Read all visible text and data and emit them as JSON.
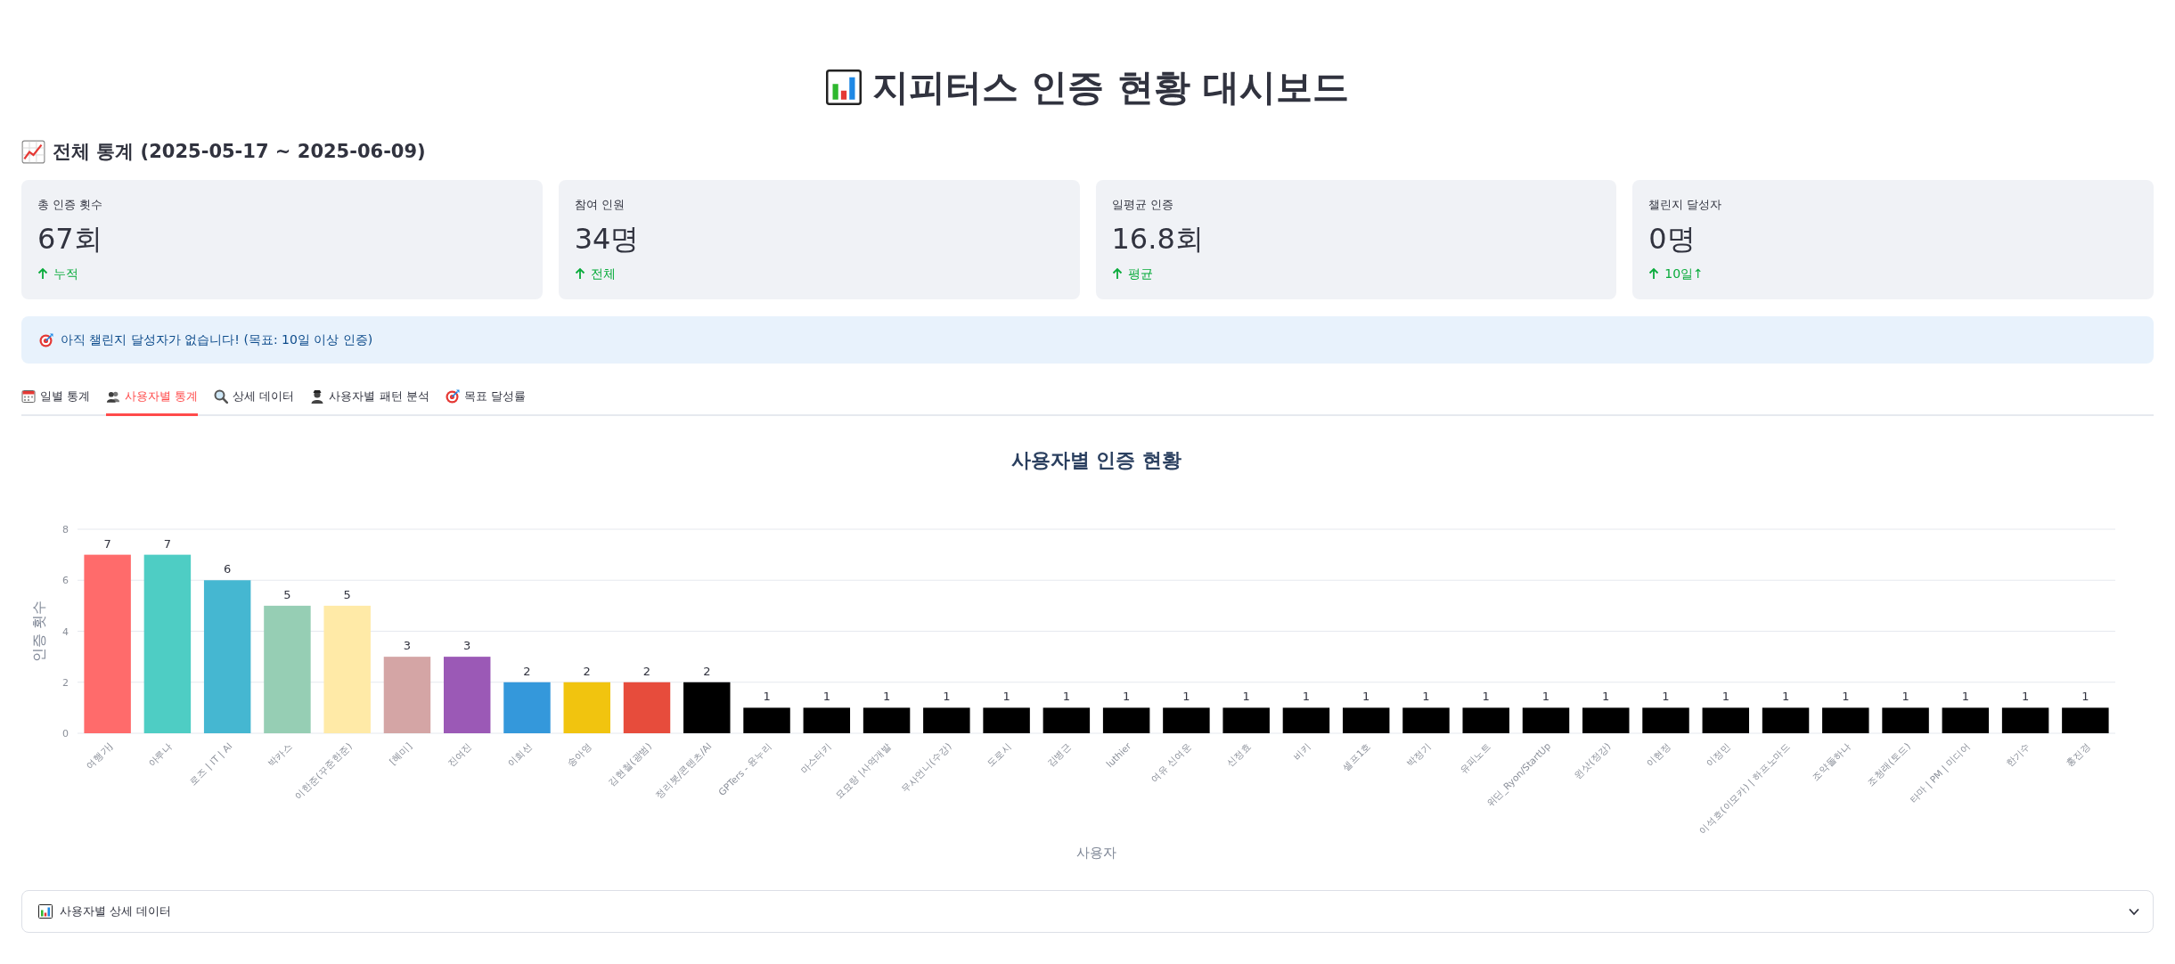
{
  "header": {
    "title": "지피터스 인증 현황 대시보드"
  },
  "overview": {
    "heading": "**전체 통계** (2025-05-17 ~ 2025-06-09)",
    "metrics": [
      {
        "label": "총 인증 횟수",
        "value": "67회",
        "delta": "누적",
        "increase": true
      },
      {
        "label": "참여 인원",
        "value": "34명",
        "delta": "전체",
        "increase": true
      },
      {
        "label": "일평균 인증",
        "value": "16.8회",
        "delta": "평균",
        "increase": true
      },
      {
        "label": "챌린지 달성자",
        "value": "0명",
        "delta": "10일↑",
        "increase": true
      }
    ]
  },
  "alert": {
    "message": "아직 챌린지 달성자가 없습니다! (목표: 10일 이상 인증)"
  },
  "tabs": [
    {
      "label": "일별 통계",
      "selected": false
    },
    {
      "label": "사용자별 통계",
      "selected": true
    },
    {
      "label": "상세 데이터",
      "selected": false
    },
    {
      "label": "사용자별 패턴 분석",
      "selected": false
    },
    {
      "label": "목표 달성률",
      "selected": false
    }
  ],
  "user_chart": {
    "chart_data": {
      "type": "bar",
      "title": "사용자별 인증 현황",
      "xlabel": "사용자",
      "ylabel": "인증 횟수",
      "categories": [
        "여행가J",
        "아루나",
        "로즈 | IT | AI",
        "박카스",
        "이한준(꾸준한준)",
        "[혜미]",
        "진여진",
        "이희선",
        "송아영",
        "김현철(광범)",
        "정리봇/콘텐츠/AI",
        "GPTers - 윤누리",
        "마스터키",
        "묘묘랑 |사역개발",
        "무사언니(수강)",
        "도로시",
        "김병근",
        "luthier",
        "여유 신여운",
        "신정효",
        "비키",
        "셀프1호",
        "박정기",
        "유피노트",
        "위딘_Ryon/StartUp",
        "윈샷(정강)",
        "이현정",
        "이정민",
        "이석호(이모카) | 하프노마드",
        "조약돌하나",
        "조청래(토드)",
        "타마 | PM | 미디어",
        "한기수",
        "홍진경"
      ],
      "series": [
        {
          "values": [
            7,
            7,
            6,
            5,
            5,
            3,
            3,
            2,
            2,
            2,
            2,
            1,
            1,
            1,
            1,
            1,
            1,
            1,
            1,
            1,
            1,
            1,
            1,
            1,
            1,
            1,
            1,
            1,
            1,
            1,
            1,
            1,
            1,
            1
          ],
          "colors": [
            "#ff6b6b",
            "#4ecdc4",
            "#45b7d1",
            "#96ceb4",
            "#ffeaa7",
            "#d4a5a5",
            "#9b59b6",
            "#3498db",
            "#f1c40f",
            "#e74c3c",
            "#000000",
            "#000000",
            "#000000",
            "#000000",
            "#000000",
            "#000000",
            "#000000",
            "#000000",
            "#000000",
            "#000000",
            "#000000",
            "#000000",
            "#000000",
            "#000000",
            "#000000",
            "#000000",
            "#000000",
            "#000000",
            "#000000",
            "#000000",
            "#000000",
            "#000000",
            "#000000",
            "#000000"
          ]
        }
      ],
      "ylim": [
        0,
        8
      ],
      "yticks": [
        0,
        2,
        4,
        6,
        8
      ],
      "grid": true,
      "data_labels": true
    }
  },
  "expander": {
    "label": "사용자별 상세 데이터",
    "expanded": false
  }
}
